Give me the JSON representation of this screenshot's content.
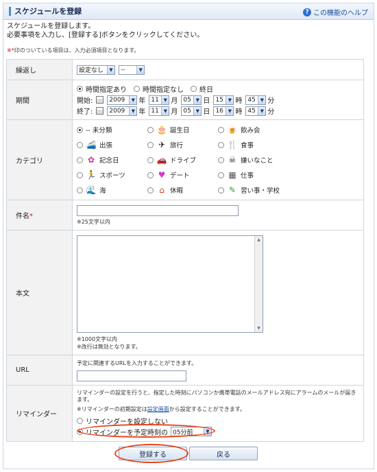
{
  "header": {
    "title": "スケジュールを登録",
    "help_label": "この機能のヘルプ"
  },
  "intro": {
    "line1": "スケジュールを登録します。",
    "line2": "必要事項を入力し、[登録する]ボタンをクリックしてください。"
  },
  "note": {
    "mark": "※*",
    "text": "印のついている項目は、入力必須項目となります。"
  },
  "repeat": {
    "label": "繰返し",
    "select1": "設定なし",
    "select2": "--"
  },
  "period": {
    "label": "期間",
    "options": [
      "時間指定あり",
      "時間指定なし",
      "終日"
    ],
    "selected_option": 0,
    "start": {
      "label": "開始:",
      "year": "2009",
      "month": "11",
      "day": "05",
      "hour": "15",
      "minute": "45"
    },
    "end": {
      "label": "終了:",
      "year": "2009",
      "month": "11",
      "day": "05",
      "hour": "16",
      "minute": "45"
    },
    "units": {
      "year": "年",
      "month": "月",
      "day": "日",
      "hour": "時",
      "minute": "分"
    }
  },
  "category": {
    "label": "カテゴリ",
    "items": [
      {
        "label": "-- 未分類",
        "icon": "none",
        "selected": true
      },
      {
        "label": "誕生日",
        "icon": "birthday-cake-icon",
        "selected": false
      },
      {
        "label": "飲み会",
        "icon": "beer-mug-icon",
        "selected": false
      },
      {
        "label": "出張",
        "icon": "train-icon",
        "selected": false
      },
      {
        "label": "旅行",
        "icon": "airplane-icon",
        "selected": false
      },
      {
        "label": "食事",
        "icon": "fork-knife-icon",
        "selected": false
      },
      {
        "label": "記念日",
        "icon": "flower-icon",
        "selected": false
      },
      {
        "label": "ドライブ",
        "icon": "car-icon",
        "selected": false
      },
      {
        "label": "嫌いなこと",
        "icon": "skull-icon",
        "selected": false
      },
      {
        "label": "スポーツ",
        "icon": "runner-icon",
        "selected": false
      },
      {
        "label": "デート",
        "icon": "heart-icon",
        "selected": false
      },
      {
        "label": "仕事",
        "icon": "building-icon",
        "selected": false
      },
      {
        "label": "海",
        "icon": "wave-icon",
        "selected": false
      },
      {
        "label": "休暇",
        "icon": "house-icon",
        "selected": false
      },
      {
        "label": "習い事・学校",
        "icon": "pencil-icon",
        "selected": false
      }
    ]
  },
  "subject": {
    "label": "件名",
    "required_mark": "*",
    "value": "",
    "hint": "※25文字以内"
  },
  "body": {
    "label": "本文",
    "value": "",
    "hint1": "※1000文字以内",
    "hint2": "※改行は無効となります。"
  },
  "url": {
    "label": "URL",
    "description": "予定に関連するURLを入力することができます。",
    "value": ""
  },
  "reminder": {
    "label": "リマインダー",
    "desc1": "リマインダーの設定を行うと、指定した時刻にパソコンか携帯電話のメールアドレス宛にアラームのメールが届きます。",
    "desc2_prefix": "※リマインダーの初期設定は",
    "desc2_link": "設定画面",
    "desc2_suffix": "から設定することができます。",
    "option_off": "リマインダーを設定しない",
    "option_on": "リマインダーを予定時刻の",
    "selected": "on",
    "offset_value": "05分前"
  },
  "buttons": {
    "submit": "登録する",
    "back": "戻る"
  },
  "colors": {
    "accent": "#5b85c0",
    "required": "#d01010",
    "highlight_oval": "#e8431b",
    "link": "#1a4fa0"
  }
}
